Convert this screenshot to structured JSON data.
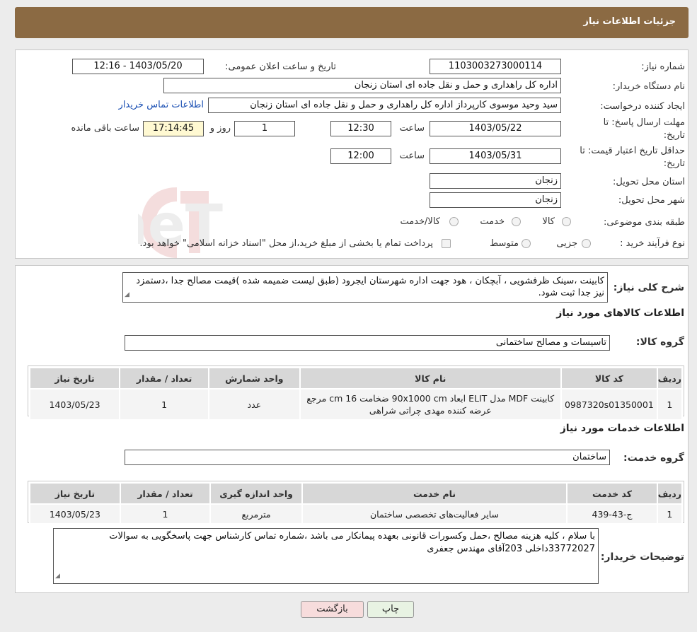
{
  "header": {
    "title": "جزئیات اطلاعات نیاز"
  },
  "form": {
    "need_number_label": "شماره نیاز:",
    "need_number": "1103003273000114",
    "announce_label": "تاریخ و ساعت اعلان عمومی:",
    "announce_value": "1403/05/20 - 12:16",
    "buyer_org_label": "نام دستگاه خریدار:",
    "buyer_org": "اداره کل راهداری و حمل و نقل جاده ای استان زنجان",
    "creator_label": "ایجاد کننده درخواست:",
    "creator": "سید وحید موسوی کارپرداز اداره کل راهداری و حمل و نقل جاده ای استان زنجان",
    "contact_link": "اطلاعات تماس خریدار",
    "deadline_label_1": "مهلت ارسال پاسخ: تا",
    "deadline_label_2": "تاریخ:",
    "deadline_date": "1403/05/22",
    "time_label": "ساعت",
    "deadline_time": "12:30",
    "days_value": "1",
    "days_label": "روز و",
    "remaining_time": "17:14:45",
    "remaining_label": "ساعت باقی مانده",
    "validity_label_1": "حداقل تاریخ اعتبار قیمت: تا",
    "validity_label_2": "تاریخ:",
    "validity_date": "1403/05/31",
    "validity_time": "12:00",
    "province_label": "استان محل تحویل:",
    "province": "زنجان",
    "city_label": "شهر محل تحویل:",
    "city": "زنجان",
    "category_label": "طبقه بندی موضوعی:",
    "category_options": [
      "کالا",
      "خدمت",
      "کالا/خدمت"
    ],
    "process_label": "نوع فرآیند خرید :",
    "process_options": [
      "جزیی",
      "متوسط"
    ],
    "process_note": "پرداخت تمام یا بخشی از مبلغ خرید،از محل \"اسناد خزانه اسلامی\" خواهد بود."
  },
  "description": {
    "label": "شرح کلی نیاز:",
    "text": "کابینت ،سینک ظرفشویی ، آبچکان ، هود جهت اداره شهرستان ایجرود (طبق لیست ضمیمه شده )قیمت مصالح جدا ،دستمزد نیز جدا ثبت شود."
  },
  "goods": {
    "section_title": "اطلاعات کالاهای مورد نیاز",
    "group_label": "گروه کالا:",
    "group_value": "تاسیسات و مصالح ساختمانی",
    "columns": [
      "ردیف",
      "کد کالا",
      "نام کالا",
      "واحد شمارش",
      "تعداد / مقدار",
      "تاریخ نیاز"
    ],
    "rows": [
      {
        "row": "1",
        "code": "0987320s01350001",
        "name": "کابینت MDF مدل ELIT ابعاد 90x1000 cm ضخامت 16 cm مرجع عرضه کننده مهدی چراتی شراهی",
        "unit": "عدد",
        "qty": "1",
        "date": "1403/05/23"
      }
    ]
  },
  "services": {
    "section_title": "اطلاعات خدمات مورد نیاز",
    "group_label": "گروه خدمت:",
    "group_value": "ساختمان",
    "columns": [
      "ردیف",
      "کد خدمت",
      "نام خدمت",
      "واحد اندازه گیری",
      "تعداد / مقدار",
      "تاریخ نیاز"
    ],
    "rows": [
      {
        "row": "1",
        "code": "ج-43-439",
        "name": "سایر فعالیت‌های تخصصی ساختمان",
        "unit": "مترمربع",
        "qty": "1",
        "date": "1403/05/23"
      }
    ]
  },
  "buyer_notes": {
    "label": "توضیحات خریدار:",
    "text": "با سلام ، کلیه هزینه مصالح ،حمل وکسورات قانونی بعهده پیمانکار می باشد ،شماره تماس کارشناس جهت پاسخگویی به سوالات 33772027داخلی 203آقای مهندس جعفری"
  },
  "buttons": {
    "print": "چاپ",
    "back": "بازگشت"
  },
  "watermark": {
    "text": "AriaTender.neT"
  }
}
